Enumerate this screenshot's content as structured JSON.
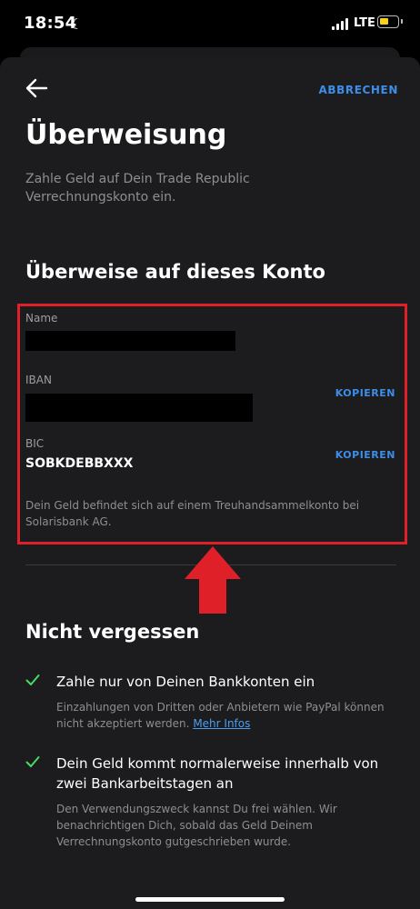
{
  "status_bar": {
    "time": "18:54",
    "network": "LTE"
  },
  "header": {
    "cancel_label": "ABBRECHEN"
  },
  "page": {
    "title": "Überweisung",
    "subtitle": "Zahle Geld auf Dein Trade Republic Verrechnungskonto ein."
  },
  "account": {
    "section_title": "Überweise auf dieses Konto",
    "name_label": "Name",
    "iban_label": "IBAN",
    "bic_label": "BIC",
    "bic_value": "SOBKDEBBXXX",
    "copy_label": "KOPIEREN",
    "note": "Dein Geld befindet sich auf einem Treuhandsammelkonto bei Solarisbank AG."
  },
  "reminders": {
    "section_title": "Nicht vergessen",
    "items": [
      {
        "heading": "Zahle nur von Deinen Bankkonten ein",
        "body": "Einzahlungen von Dritten oder Anbietern wie PayPal können nicht akzeptiert werden.",
        "link": "Mehr Infos"
      },
      {
        "heading": "Dein Geld kommt normalerweise innerhalb von zwei Bankarbeitstagen an",
        "body": "Den Verwendungszweck kannst Du frei wählen. Wir benachrichtigen Dich, sobald das Geld Deinem Verrechnungskonto gutgeschrieben wurde."
      }
    ]
  },
  "colors": {
    "accent": "#3d8ee8",
    "check": "#4cd964",
    "highlight": "#e02028",
    "background": "#1c1c1e"
  },
  "icons": [
    "moon-icon",
    "signal-icon",
    "battery-icon",
    "back-arrow-icon",
    "checkmark-icon"
  ]
}
